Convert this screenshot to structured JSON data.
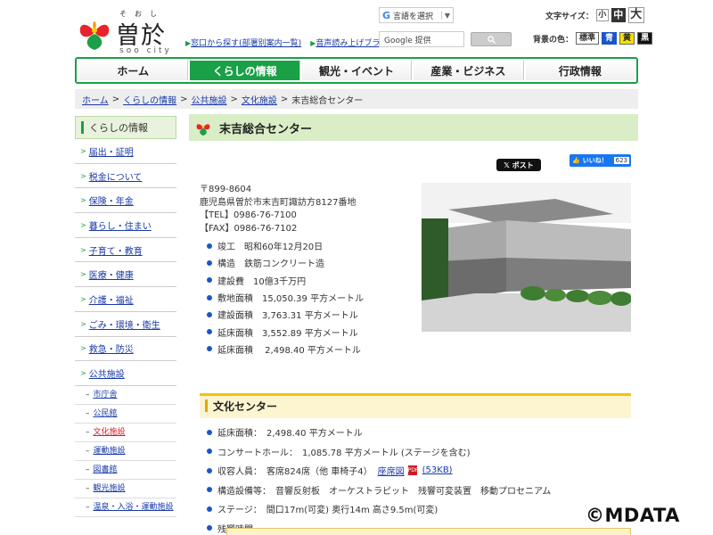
{
  "header": {
    "logo_ruby": "そおし",
    "logo_name": "曽於市",
    "logo_en": "soo city",
    "translate_label": "言語を選択",
    "links": [
      "窓口から探す(部署別案内一覧)",
      "音声読み上げブラウザ"
    ],
    "search_placeholder": "Google 提供",
    "font_size_label": "文字サイズ：",
    "font_sizes": [
      "小",
      "中",
      "大"
    ],
    "bg_color_label": "背景の色：",
    "bg_colors": [
      "標準",
      "青",
      "黄",
      "黒"
    ]
  },
  "nav": [
    "ホーム",
    "くらしの情報",
    "観光・イベント",
    "産業・ビジネス",
    "行政情報"
  ],
  "breadcrumb": [
    "ホーム",
    "くらしの情報",
    "公共施設",
    "文化施設",
    "末吉総合センター"
  ],
  "sidebar": {
    "heading": "くらしの情報",
    "items": [
      "届出・証明",
      "税金について",
      "保険・年金",
      "暮らし・住まい",
      "子育て・教育",
      "医療・健康",
      "介護・福祉",
      "ごみ・環境・衛生",
      "救急・防災",
      "公共施設"
    ],
    "subitems": [
      "市庁舎",
      "公民館",
      "文化施設",
      "運動施設",
      "図書館",
      "観光施設",
      "温泉・入浴・運動施設"
    ]
  },
  "main": {
    "title": "末吉総合センター",
    "xpost": "ポスト",
    "fb_like": "いいね！",
    "fb_count": "623",
    "address": [
      "〒899-8604",
      "鹿児島県曽於市末吉町諏訪方8127番地",
      "【TEL】0986-76-7100",
      "【FAX】0986-76-7102"
    ],
    "specs": [
      "竣工　昭和60年12月20日",
      "構造　鉄筋コンクリート造",
      "建設費　10億3千万円",
      "敷地面積　15,050.39 平方メートル",
      "建設面積　3,763.31 平方メートル",
      "延床面積　3,552.89 平方メートル",
      "延床面積　 2,498.40 平方メートル"
    ],
    "section_title": "文化センター",
    "bunka": [
      "延床面積：　2,498.40 平方メートル",
      "コンサートホール：　1,085.78 平方メートル (ステージを含む)",
      "収容人員：　客席824席（他 車椅子4）",
      "構造設備等：　音響反射板　オーケストラピット　残響可変装置　移動プロセニアム",
      "ステージ：　間口17m(可変) 奥行14m 高さ9.5m(可変)",
      "残響時間"
    ],
    "seating_link": "座席図",
    "pdf_size": "(53KB)"
  },
  "watermark": "©MDATA"
}
